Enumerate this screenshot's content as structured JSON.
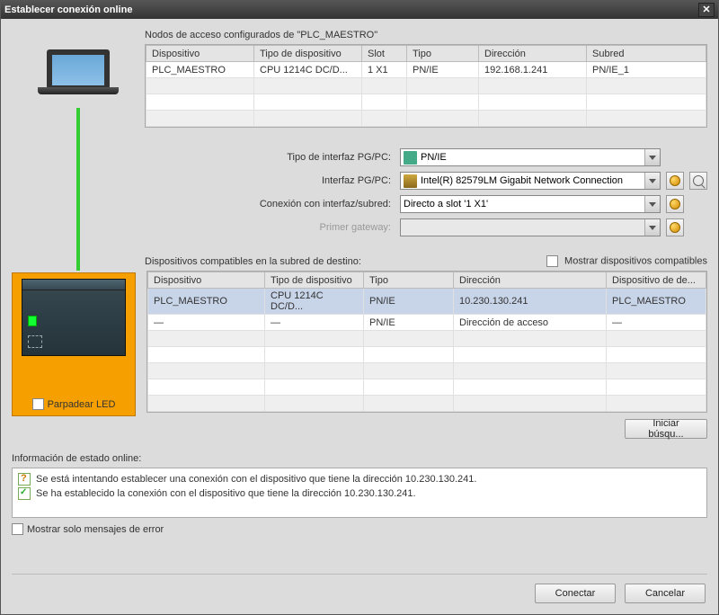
{
  "title": "Establecer conexión online",
  "access_nodes": {
    "label": "Nodos de acceso configurados de \"PLC_MAESTRO\"",
    "headers": {
      "device": "Dispositivo",
      "devtype": "Tipo de dispositivo",
      "slot": "Slot",
      "type": "Tipo",
      "address": "Dirección",
      "subnet": "Subred"
    },
    "row": {
      "device": "PLC_MAESTRO",
      "devtype": "CPU 1214C DC/D...",
      "slot": "1 X1",
      "type": "PN/IE",
      "address": "192.168.1.241",
      "subnet": "PN/IE_1"
    }
  },
  "form": {
    "pgpc_type_label": "Tipo de interfaz PG/PC:",
    "pgpc_type_value": "PN/IE",
    "pgpc_if_label": "Interfaz PG/PC:",
    "pgpc_if_value": "Intel(R) 82579LM Gigabit Network Connection",
    "subnet_label": "Conexión con interfaz/subred:",
    "subnet_value": "Directo a slot '1 X1'",
    "gateway_label": "Primer gateway:",
    "gateway_value": ""
  },
  "compatible": {
    "label": "Dispositivos compatibles en la subred de destino:",
    "checkbox_label": "Mostrar dispositivos compatibles",
    "headers": {
      "device": "Dispositivo",
      "devtype": "Tipo de dispositivo",
      "type": "Tipo",
      "address": "Dirección",
      "target": "Dispositivo de de..."
    },
    "rows": [
      {
        "device": "PLC_MAESTRO",
        "devtype": "CPU 1214C DC/D...",
        "type": "PN/IE",
        "address": "10.230.130.241",
        "target": "PLC_MAESTRO"
      },
      {
        "device": "—",
        "devtype": "—",
        "type": "PN/IE",
        "address": "Dirección de acceso",
        "target": "—"
      }
    ]
  },
  "led_checkbox": "Parpadear LED",
  "start_search": "Iniciar búsqu...",
  "status": {
    "label": "Información de estado online:",
    "line1": "Se está intentando establecer una conexión con el dispositivo que tiene la dirección 10.230.130.241.",
    "line2": "Se ha establecido la conexión con el dispositivo que tiene la dirección 10.230.130.241."
  },
  "err_only": "Mostrar solo mensajes de error",
  "buttons": {
    "connect": "Conectar",
    "cancel": "Cancelar"
  }
}
